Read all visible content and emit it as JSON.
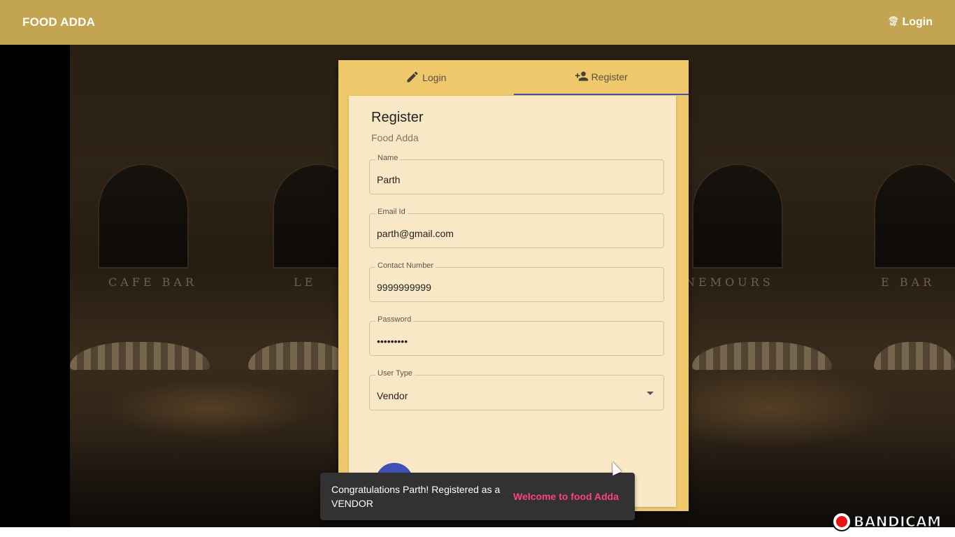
{
  "appbar": {
    "brand": "FOOD ADDA",
    "login_label": "Login",
    "login_icon": "fingerprint-icon"
  },
  "card": {
    "tabs": [
      {
        "label": "Login",
        "icon": "edit-icon",
        "active": false
      },
      {
        "label": "Register",
        "icon": "person-add-icon",
        "active": true
      }
    ],
    "title": "Register",
    "subtitle": "Food Adda",
    "fields": {
      "name": {
        "label": "Name",
        "value": "Parth"
      },
      "email": {
        "label": "Email Id",
        "value": "parth@gmail.com"
      },
      "contact": {
        "label": "Contact Number",
        "value": "9999999999"
      },
      "password": {
        "label": "Password",
        "value": "•••••••••"
      },
      "user_type": {
        "label": "User Type",
        "value": "Vendor"
      }
    }
  },
  "snackbar": {
    "message": "Congratulations Parth! Registered as a VENDOR",
    "action": "Welcome to food Adda"
  },
  "watermark": {
    "text": "BANDICAM"
  },
  "colors": {
    "appbar": "#c3a450",
    "card": "#f0c86c",
    "panel": "#f9e8c5",
    "tab_indicator": "#3f51b5",
    "snackbar_action": "#ff4081"
  }
}
